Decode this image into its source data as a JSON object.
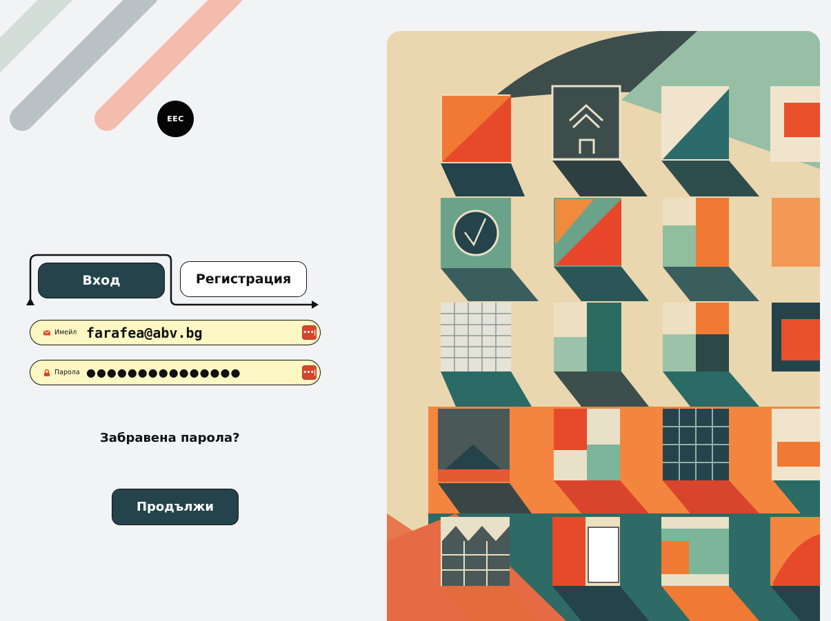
{
  "logo": {
    "text": "EEC"
  },
  "tabs": {
    "login_label": "Вход",
    "register_label": "Регистрация"
  },
  "form": {
    "email_label": "Имейл",
    "email_value": "farafea@abv.bg",
    "password_label": "Парола",
    "password_value": "●●●●●●●●●●●●●●●",
    "password_manager_badge": "•••|"
  },
  "forgot_password": "Забравена парола?",
  "continue_label": "Продължи",
  "colors": {
    "primary": "#24434b",
    "field_bg": "#fdf7c3",
    "accent_red": "#d9452c",
    "stripe_green": "#d3ddd8",
    "stripe_gray": "#b9c1c5",
    "stripe_pink": "#f3bcad"
  },
  "illustration": {
    "name": "geometric-buildings-art"
  }
}
